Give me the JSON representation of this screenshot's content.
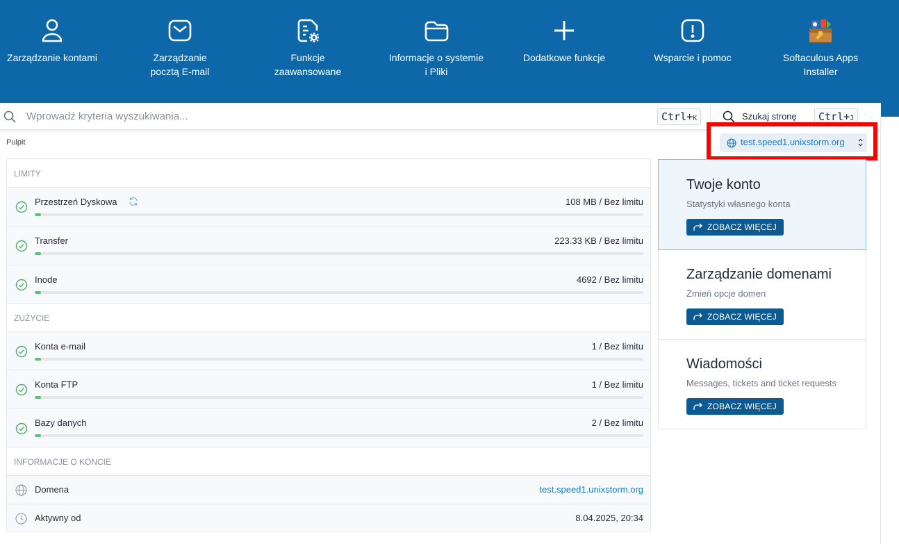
{
  "nav": {
    "items": [
      {
        "label": "Zarządzanie kontami",
        "icon": "user-icon"
      },
      {
        "label": "Zarządzanie pocztą E-mail",
        "icon": "mail-icon"
      },
      {
        "label": "Funkcje zaawansowane",
        "icon": "file-settings-icon"
      },
      {
        "label": "Informacje o systemie i Pliki",
        "icon": "folder-icon"
      },
      {
        "label": "Dodatkowe funkcje",
        "icon": "plus-icon"
      },
      {
        "label": "Wsparcie i pomoc",
        "icon": "alert-icon"
      },
      {
        "label": "Softaculous Apps Installer",
        "icon": "softaculous-icon"
      }
    ]
  },
  "search": {
    "placeholder": "Wprowadź kryteria wyszukiwania...",
    "shortcut_main": "Ctrl+",
    "shortcut_key": "K",
    "page_search_label": "Szukaj stronę",
    "page_shortcut_main": "Ctrl+",
    "page_shortcut_key": "J"
  },
  "breadcrumb": "Pulpit",
  "domain_select": {
    "value": "test.speed1.unixstorm.org"
  },
  "limits": {
    "heading": "LIMITY",
    "rows": [
      {
        "name": "Przestrzeń Dyskowa",
        "value": "108 MB / Bez limitu",
        "usage_pct": 1
      },
      {
        "name": "Transfer",
        "value": "223.33 KB / Bez limitu",
        "usage_pct": 1
      },
      {
        "name": "Inode",
        "value": "4692 / Bez limitu",
        "usage_pct": 1
      }
    ]
  },
  "usage": {
    "heading": "ZUŻYCIE",
    "rows": [
      {
        "name": "Konta e-mail",
        "value": "1 / Bez limitu",
        "usage_pct": 1
      },
      {
        "name": "Konta FTP",
        "value": "1 / Bez limitu",
        "usage_pct": 1
      },
      {
        "name": "Bazy danych",
        "value": "2 / Bez limitu",
        "usage_pct": 1
      }
    ]
  },
  "account_info": {
    "heading": "INFORMACJE O KONCIE",
    "domain_label": "Domena",
    "domain_value": "test.speed1.unixstorm.org",
    "active_label": "Aktywny od",
    "active_value": "8.04.2025, 20:34"
  },
  "cards": [
    {
      "title": "Twoje konto",
      "subtitle": "Statystyki własnego konta",
      "button": "ZOBACZ WIĘCEJ"
    },
    {
      "title": "Zarządzanie domenami",
      "subtitle": "Zmień opcje domen",
      "button": "ZOBACZ WIĘCEJ"
    },
    {
      "title": "Wiadomości",
      "subtitle": "Messages, tickets and ticket requests",
      "button": "ZOBACZ WIĘCEJ"
    }
  ],
  "colors": {
    "nav_bg": "#0d67a8",
    "accent_link": "#1a7bc4",
    "button_bg": "#0c5a92",
    "progress_fill": "#5bc47c",
    "highlight": "#ff0000"
  }
}
